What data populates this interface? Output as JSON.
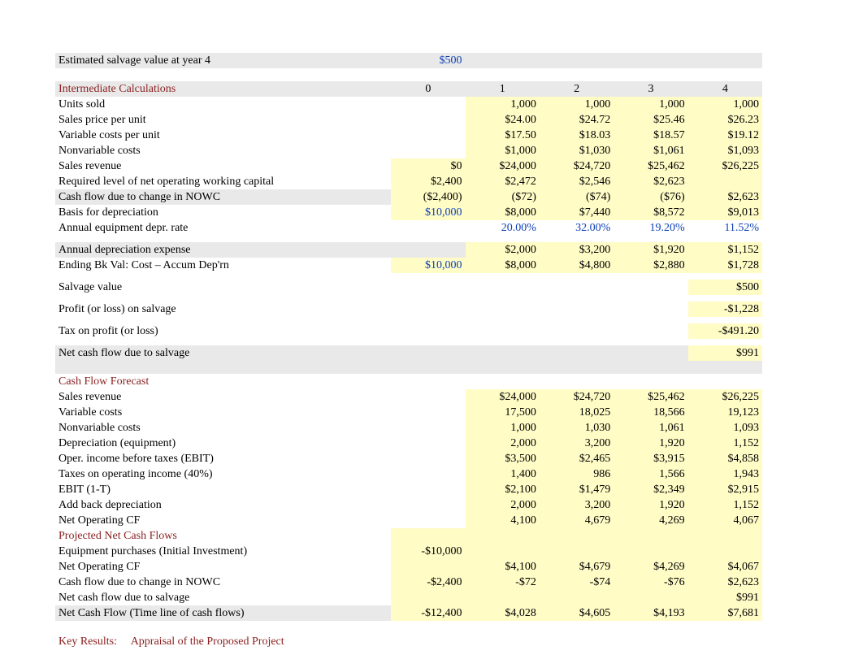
{
  "salvage_row": {
    "label": "Estimated salvage value at year 4",
    "value": "$500"
  },
  "headers": {
    "intermediate": "Intermediate Calculations",
    "cols": [
      "0",
      "1",
      "2",
      "3",
      "4"
    ]
  },
  "intermediate": [
    {
      "label": "Units sold",
      "v": [
        "",
        "1,000",
        "1,000",
        "1,000",
        "1,000"
      ]
    },
    {
      "label": "Sales price per unit",
      "v": [
        "",
        "$24.00",
        "$24.72",
        "$25.46",
        "$26.23"
      ]
    },
    {
      "label": "Variable costs per unit",
      "v": [
        "",
        "$17.50",
        "$18.03",
        "$18.57",
        "$19.12"
      ]
    },
    {
      "label": "Nonvariable costs",
      "v": [
        "",
        "$1,000",
        "$1,030",
        "$1,061",
        "$1,093"
      ]
    },
    {
      "label": "Sales revenue",
      "v": [
        "$0",
        "$24,000",
        "$24,720",
        "$25,462",
        "$26,225"
      ]
    },
    {
      "label": "Required level of net operating working capital",
      "v": [
        "$2,400",
        "$2,472",
        "$2,546",
        "$2,623",
        ""
      ]
    },
    {
      "label": "Cash flow due to change in NOWC",
      "v": [
        "($2,400)",
        "($72)",
        "($74)",
        "($76)",
        "$2,623"
      ]
    },
    {
      "label": "Basis for depreciation",
      "v": [
        "$10,000",
        "$8,000",
        "$7,440",
        "$8,572",
        "$9,013"
      ]
    },
    {
      "label": "Annual equipment depr. rate",
      "v": [
        "",
        "20.00%",
        "32.00%",
        "19.20%",
        "11.52%"
      ]
    },
    {
      "label": "Annual depreciation expense",
      "v": [
        "",
        "$2,000",
        "$3,200",
        "$1,920",
        "$1,152"
      ]
    },
    {
      "label": "Ending Bk Val: Cost – Accum Dep'rn",
      "v": [
        "$10,000",
        "$8,000",
        "$4,800",
        "$2,880",
        "$1,728"
      ]
    },
    {
      "label": "Salvage value",
      "v": [
        "",
        "",
        "",
        "",
        "$500"
      ]
    },
    {
      "label": "Profit (or loss) on salvage",
      "v": [
        "",
        "",
        "",
        "",
        "-$1,228"
      ]
    },
    {
      "label": "Tax on profit (or loss)",
      "v": [
        "",
        "",
        "",
        "",
        "-$491.20"
      ]
    },
    {
      "label": "Net cash flow due to salvage",
      "v": [
        "",
        "",
        "",
        "",
        "$991"
      ]
    }
  ],
  "cff_header": "Cash Flow Forecast",
  "cff": [
    {
      "label": "Sales revenue",
      "v": [
        "",
        "$24,000",
        "$24,720",
        "$25,462",
        "$26,225"
      ]
    },
    {
      "label": "Variable costs",
      "v": [
        "",
        "17,500",
        "18,025",
        "18,566",
        "19,123"
      ]
    },
    {
      "label": "Nonvariable costs",
      "v": [
        "",
        "1,000",
        "1,030",
        "1,061",
        "1,093"
      ]
    },
    {
      "label": "Depreciation (equipment)",
      "v": [
        "",
        "2,000",
        "3,200",
        "1,920",
        "1,152"
      ]
    },
    {
      "label": "Oper. income before taxes (EBIT)",
      "v": [
        "",
        "$3,500",
        "$2,465",
        "$3,915",
        "$4,858"
      ]
    },
    {
      "label": "Taxes on operating income (40%)",
      "v": [
        "",
        "1,400",
        "986",
        "1,566",
        "1,943"
      ]
    },
    {
      "label": "EBIT (1-T)",
      "v": [
        "",
        "$2,100",
        "$1,479",
        "$2,349",
        "$2,915"
      ]
    },
    {
      "label": "Add back depreciation",
      "v": [
        "",
        "2,000",
        "3,200",
        "1,920",
        "1,152"
      ]
    },
    {
      "label": "Net Operating CF",
      "v": [
        "",
        "4,100",
        "4,679",
        "4,269",
        "4,067"
      ]
    }
  ],
  "proj_header": "Projected Net Cash Flows",
  "proj": [
    {
      "label": "Equipment purchases (Initial Investment)",
      "v": [
        "-$10,000",
        "",
        "",
        "",
        ""
      ]
    },
    {
      "label": "Net Operating CF",
      "v": [
        "",
        "$4,100",
        "$4,679",
        "$4,269",
        "$4,067"
      ]
    },
    {
      "label": "Cash flow due to change in NOWC",
      "v": [
        "-$2,400",
        "-$72",
        "-$74",
        "-$76",
        "$2,623"
      ]
    },
    {
      "label": "Net cash flow due to salvage",
      "v": [
        "",
        "",
        "",
        "",
        "$991"
      ]
    },
    {
      "label": "Net Cash Flow (Time line of cash flows)",
      "v": [
        "-$12,400",
        "$4,028",
        "$4,605",
        "$4,193",
        "$7,681"
      ]
    }
  ],
  "key_results": {
    "label": "Key Results:",
    "text": "Appraisal of the Proposed Project"
  },
  "styles": {
    "intermediate_grey_rows": [
      6,
      9,
      14
    ],
    "intermediate_blue_rows": [
      7,
      8,
      10
    ],
    "intermediate_blue_cells": {
      "7": [
        0
      ],
      "8": [
        1,
        2,
        3,
        4
      ],
      "10": [
        0
      ]
    },
    "intermediate_yellow_rows": [
      0,
      1,
      2,
      3,
      4,
      5,
      6,
      7,
      9,
      10,
      11,
      12,
      13,
      14
    ],
    "intermediate_yellow_start": {
      "0": 1,
      "1": 1,
      "2": 1,
      "3": 1,
      "4": 0,
      "5": 0,
      "6": 0,
      "7": 0,
      "9": 1,
      "10": 0,
      "11": 4,
      "12": 4,
      "13": 4,
      "14": 4
    },
    "cff_yellow_start": 0,
    "proj_grey_rows": [
      4
    ],
    "proj_yellow": true
  }
}
